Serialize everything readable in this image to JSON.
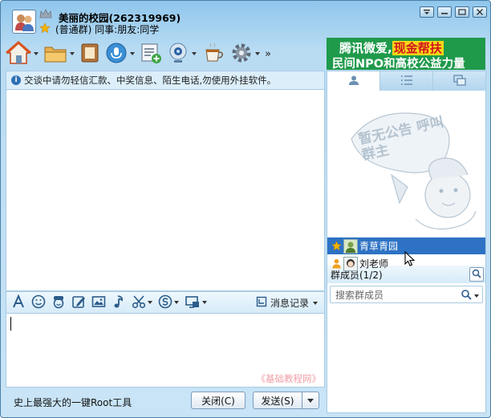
{
  "window": {
    "group_name": "美丽的校园(262319969)",
    "group_info": "(普通群) 同事:朋友:同学",
    "controls": [
      "menu",
      "minimize",
      "maximize",
      "close"
    ]
  },
  "toolbar": {
    "tools": [
      {
        "icon": "home-icon"
      },
      {
        "icon": "folder-icon"
      },
      {
        "icon": "album-icon"
      },
      {
        "icon": "voice-icon"
      },
      {
        "icon": "add-app-icon"
      },
      {
        "icon": "webcam-icon"
      },
      {
        "icon": "coffee-icon"
      },
      {
        "icon": "settings-icon"
      }
    ],
    "more": "»"
  },
  "banner": {
    "line1_a": "腾讯微爱,",
    "line1_b": "现金帮扶",
    "line2": "民间NPO和高校公益力量"
  },
  "notice": {
    "text": "交谈中请勿轻信汇款、中奖信息、陌生电话,勿使用外挂软件。"
  },
  "input_toolbar": {
    "tools": [
      "font-icon",
      "emoji-icon",
      "magic-face-icon",
      "doodle-icon",
      "image-icon",
      "music-icon",
      "screenshot-icon",
      "points-icon",
      "screen-share-icon"
    ],
    "history_label": "消息记录"
  },
  "input": {
    "value": "",
    "watermark": "《基础教程网》"
  },
  "footer": {
    "ad_text": "史上最强大的一键Root工具",
    "close_label": "关闭(C)",
    "send_label": "发送(S)"
  },
  "right_panel": {
    "tabs": [
      {
        "icon": "members-tab-icon",
        "active": true
      },
      {
        "icon": "list-tab-icon",
        "active": false
      },
      {
        "icon": "window-tab-icon",
        "active": false
      }
    ],
    "announcement_text": "暂无公告 呼叫群主",
    "members_title": "群成员(1/2)",
    "search_placeholder": "搜索群成员",
    "members": [
      {
        "name": "青草青园",
        "role": "owner",
        "selected": true
      },
      {
        "name": "刘老师",
        "role": "admin",
        "selected": false
      }
    ]
  },
  "colors": {
    "banner_bg": "#1f9a4b",
    "banner_highlight": "#f7d617",
    "selection": "#2d72c4",
    "frame": "#b9dcf3"
  }
}
